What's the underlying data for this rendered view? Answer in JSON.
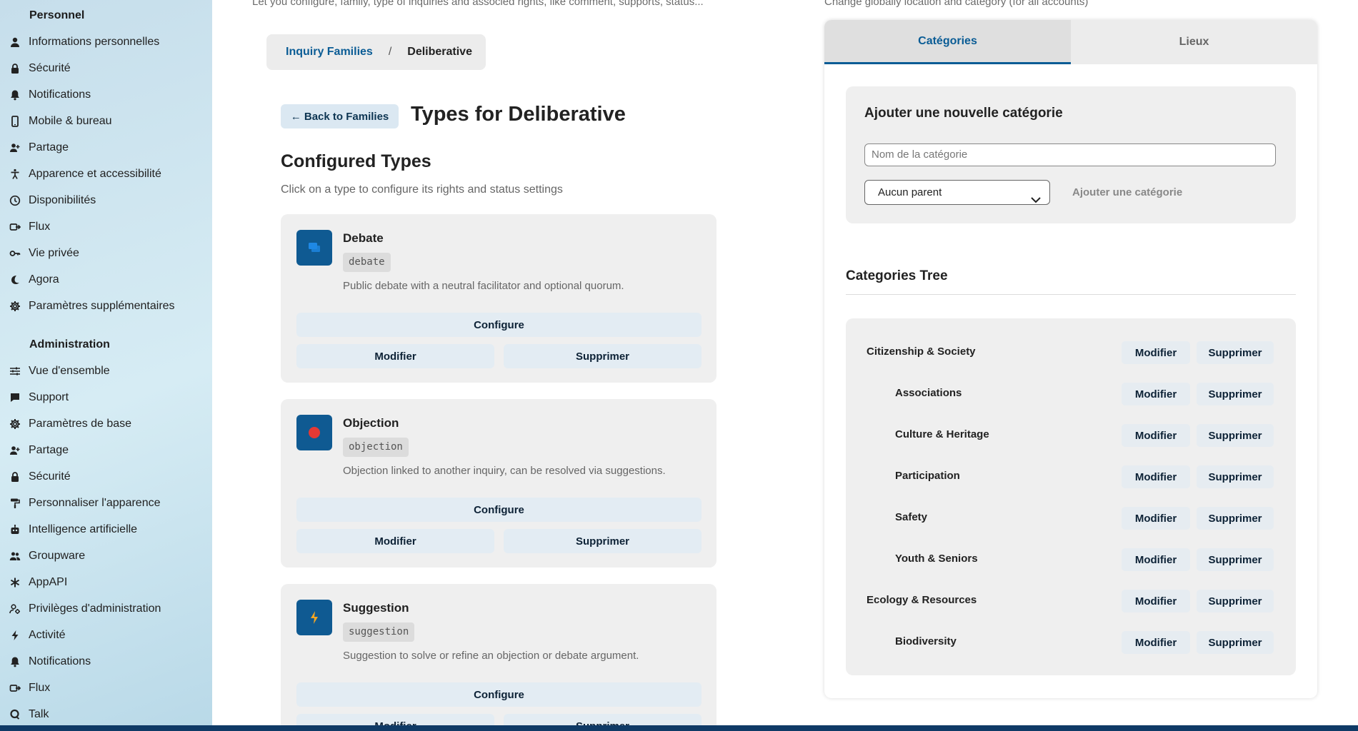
{
  "sidebar": {
    "personal_title": "Personnel",
    "personal_items": [
      {
        "label": "Informations personnelles",
        "icon": "user-icon"
      },
      {
        "label": "Sécurité",
        "icon": "lock-icon"
      },
      {
        "label": "Notifications",
        "icon": "bell-icon"
      },
      {
        "label": "Mobile & bureau",
        "icon": "phone-icon"
      },
      {
        "label": "Partage",
        "icon": "share-user-icon"
      },
      {
        "label": "Apparence et accessibilité",
        "icon": "accessibility-icon"
      },
      {
        "label": "Disponibilités",
        "icon": "clock-icon"
      },
      {
        "label": "Flux",
        "icon": "flow-icon"
      },
      {
        "label": "Vie privée",
        "icon": "key-icon"
      },
      {
        "label": "Agora",
        "icon": "agora-icon"
      },
      {
        "label": "Paramètres supplémentaires",
        "icon": "gear-icon"
      }
    ],
    "admin_title": "Administration",
    "admin_items": [
      {
        "label": "Vue d'ensemble",
        "icon": "sliders-icon"
      },
      {
        "label": "Support",
        "icon": "chat-icon"
      },
      {
        "label": "Paramètres de base",
        "icon": "gear-icon"
      },
      {
        "label": "Partage",
        "icon": "share-user-icon"
      },
      {
        "label": "Sécurité",
        "icon": "lock-icon"
      },
      {
        "label": "Personnaliser l'apparence",
        "icon": "paint-roller-icon"
      },
      {
        "label": "Intelligence artificielle",
        "icon": "robot-icon"
      },
      {
        "label": "Groupware",
        "icon": "group-icon"
      },
      {
        "label": "AppAPI",
        "icon": "asterisk-icon"
      },
      {
        "label": "Privilèges d'administration",
        "icon": "admin-user-icon"
      },
      {
        "label": "Activité",
        "icon": "lightning-icon"
      },
      {
        "label": "Notifications",
        "icon": "bell-icon"
      },
      {
        "label": "Flux",
        "icon": "flow-icon"
      },
      {
        "label": "Talk",
        "icon": "talk-icon"
      }
    ]
  },
  "main": {
    "top_cut_text": "Let you configure, family, type of inquiries and associed rights, like comment, supports, status...",
    "breadcrumb": {
      "link": "Inquiry Families",
      "separator": "/",
      "current": "Deliberative"
    },
    "back_button": "← Back to Families",
    "page_title": "Types for Deliberative",
    "section_title": "Configured Types",
    "section_subtitle": "Click on a type to configure its rights and status settings",
    "configure_label": "Configure",
    "modify_label": "Modifier",
    "delete_label": "Supprimer",
    "types": [
      {
        "name": "Debate",
        "key": "debate",
        "description": "Public debate with a neutral facilitator and optional quorum.",
        "icon": "chat-bubbles-icon",
        "icon_color": "#1e88e5"
      },
      {
        "name": "Objection",
        "key": "objection",
        "description": "Objection linked to another inquiry, can be resolved via suggestions.",
        "icon": "stop-circle-icon",
        "icon_color": "#e53935"
      },
      {
        "name": "Suggestion",
        "key": "suggestion",
        "description": "Suggestion to solve or refine an objection or debate argument.",
        "icon": "lightning-icon",
        "icon_color": "#f5a623"
      }
    ]
  },
  "right": {
    "top_cut_text": "Change globally location and category (for all accounts)",
    "tabs": [
      {
        "label": "Catégories",
        "active": true
      },
      {
        "label": "Lieux",
        "active": false
      }
    ],
    "add_category": {
      "title": "Ajouter une nouvelle catégorie",
      "name_placeholder": "Nom de la catégorie",
      "parent_selected": "Aucun parent",
      "add_button": "Ajouter une catégorie"
    },
    "tree_title": "Categories Tree",
    "tree": [
      {
        "name": "Citizenship & Society",
        "level": 0
      },
      {
        "name": "Associations",
        "level": 1
      },
      {
        "name": "Culture & Heritage",
        "level": 1
      },
      {
        "name": "Participation",
        "level": 1
      },
      {
        "name": "Safety",
        "level": 1
      },
      {
        "name": "Youth & Seniors",
        "level": 1
      },
      {
        "name": "Ecology & Resources",
        "level": 0
      },
      {
        "name": "Biodiversity",
        "level": 1
      }
    ],
    "modify_label": "Modifier",
    "delete_label": "Supprimer"
  },
  "colors": {
    "accent": "#0a5c95",
    "bottom_bar": "#0f3a66"
  }
}
